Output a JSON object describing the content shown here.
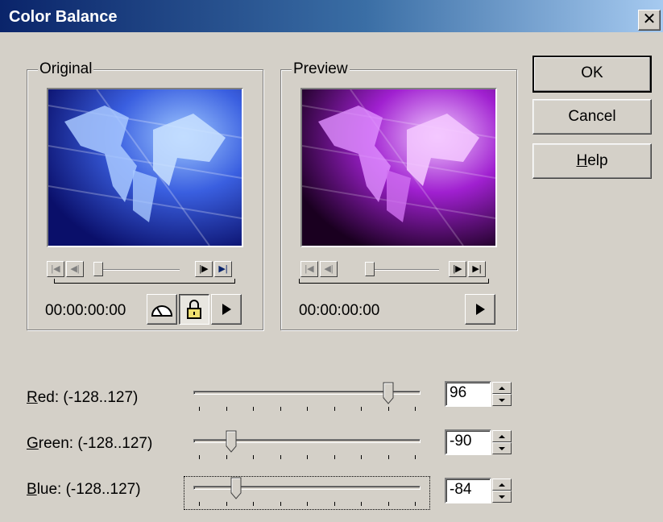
{
  "window": {
    "title": "Color Balance",
    "close_glyph": "✕"
  },
  "buttons": {
    "ok": "OK",
    "cancel": "Cancel",
    "help": "Help"
  },
  "original": {
    "label": "Original",
    "timecode": "00:00:00:00",
    "icons": [
      "go-to-start-icon",
      "step-back-icon",
      "step-forward-icon",
      "go-to-end-icon",
      "gauge-icon",
      "lock-icon",
      "play-icon"
    ]
  },
  "preview": {
    "label": "Preview",
    "timecode": "00:00:00:00",
    "icons": [
      "go-to-start-icon",
      "step-back-icon",
      "step-forward-icon",
      "go-to-end-icon",
      "play-icon"
    ]
  },
  "sliders": [
    {
      "label": "Red: (-128..127)",
      "accel": "R",
      "rest": "ed: (-128..127)",
      "value": "96",
      "num": 96,
      "min": -128,
      "max": 127
    },
    {
      "label": "Green: (-128..127)",
      "accel": "G",
      "rest": "reen: (-128..127)",
      "value": "-90",
      "num": -90,
      "min": -128,
      "max": 127
    },
    {
      "label": "Blue: (-128..127)",
      "accel": "B",
      "rest": "lue: (-128..127)",
      "value": "-84",
      "num": -84,
      "min": -128,
      "max": 127
    }
  ],
  "colors": {
    "title_bar_start": "#0a246a",
    "title_bar_end": "#a6caf0",
    "dialog_bg": "#d4d0c8",
    "original_tint": "#2a4fd8",
    "preview_tint": "#9b1fd1"
  }
}
